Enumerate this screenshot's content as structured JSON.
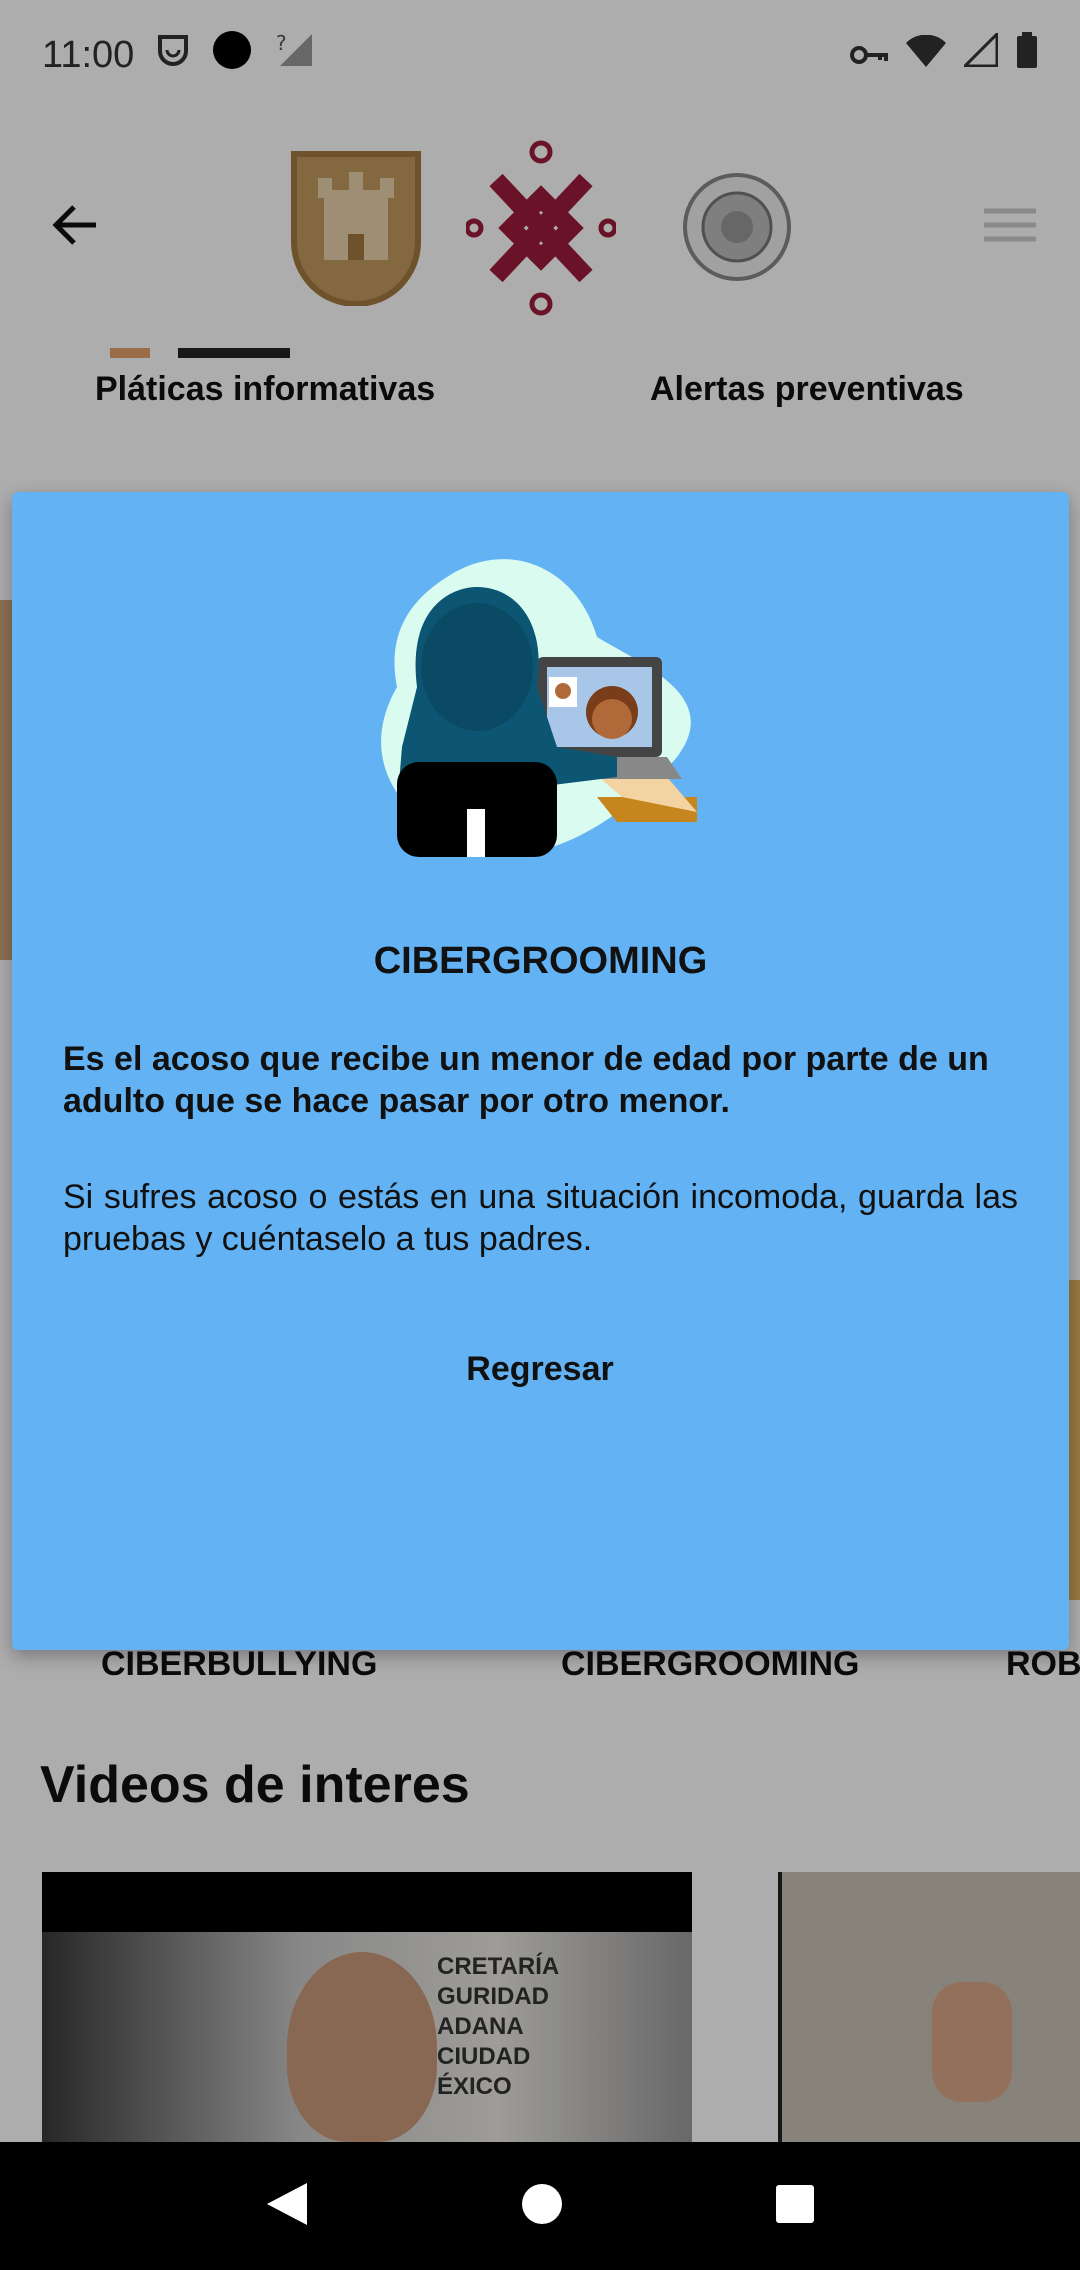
{
  "status_bar": {
    "time": "11:00",
    "icons": [
      "face-icon",
      "circle-icon",
      "no-signal-icon",
      "key-icon",
      "wifi-icon",
      "signal-icon",
      "battery-icon"
    ]
  },
  "header": {
    "back_icon": "arrow-left-icon",
    "logos": [
      "cdmx-shield-logo",
      "cdmx-emblem-logo",
      "police-badge-logo"
    ],
    "menu_icon": "hamburger-icon"
  },
  "categories": [
    "Pláticas informativas",
    "Alertas preventivas"
  ],
  "dialog": {
    "title": "CIBERGROOMING",
    "lead": "Es el acoso que recibe un menor de edad por parte de un adulto que se hace pasar por otro menor.",
    "body": "Si sufres acoso o estás en una situación incomoda, guarda las pruebas y cuéntaselo a tus padres.",
    "button": "Regresar",
    "accent": "#63b3f4"
  },
  "topics": [
    "CIBERBULLYING",
    "CIBERGROOMING",
    "ROB"
  ],
  "videos": {
    "title": "Videos de interes",
    "card1_text": "CRETARÍA\nGURIDAD\nADANA\nCIUDAD\nÉXICO"
  }
}
